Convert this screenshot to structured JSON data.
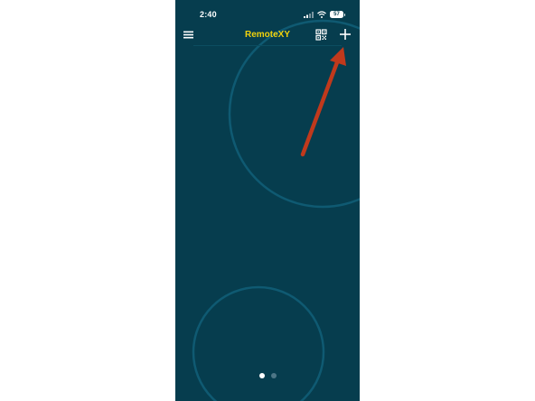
{
  "status_bar": {
    "time": "2:40",
    "battery": "57",
    "icons": [
      "cellular-signal-icon",
      "wifi-icon",
      "battery-icon"
    ]
  },
  "app_bar": {
    "title": "RemoteXY",
    "left_icon": "hamburger-menu-icon",
    "right_icons": [
      "qr-code-icon",
      "plus-icon"
    ]
  },
  "pager": {
    "page_count": 2,
    "active_index": 0
  },
  "annotation": {
    "type": "arrow",
    "target": "add-button",
    "color": "#c0391c"
  },
  "colors": {
    "background": "#063d4e",
    "title": "#f1d20c",
    "decorative_ring": "#0f5a72",
    "icon": "#ffffff"
  }
}
